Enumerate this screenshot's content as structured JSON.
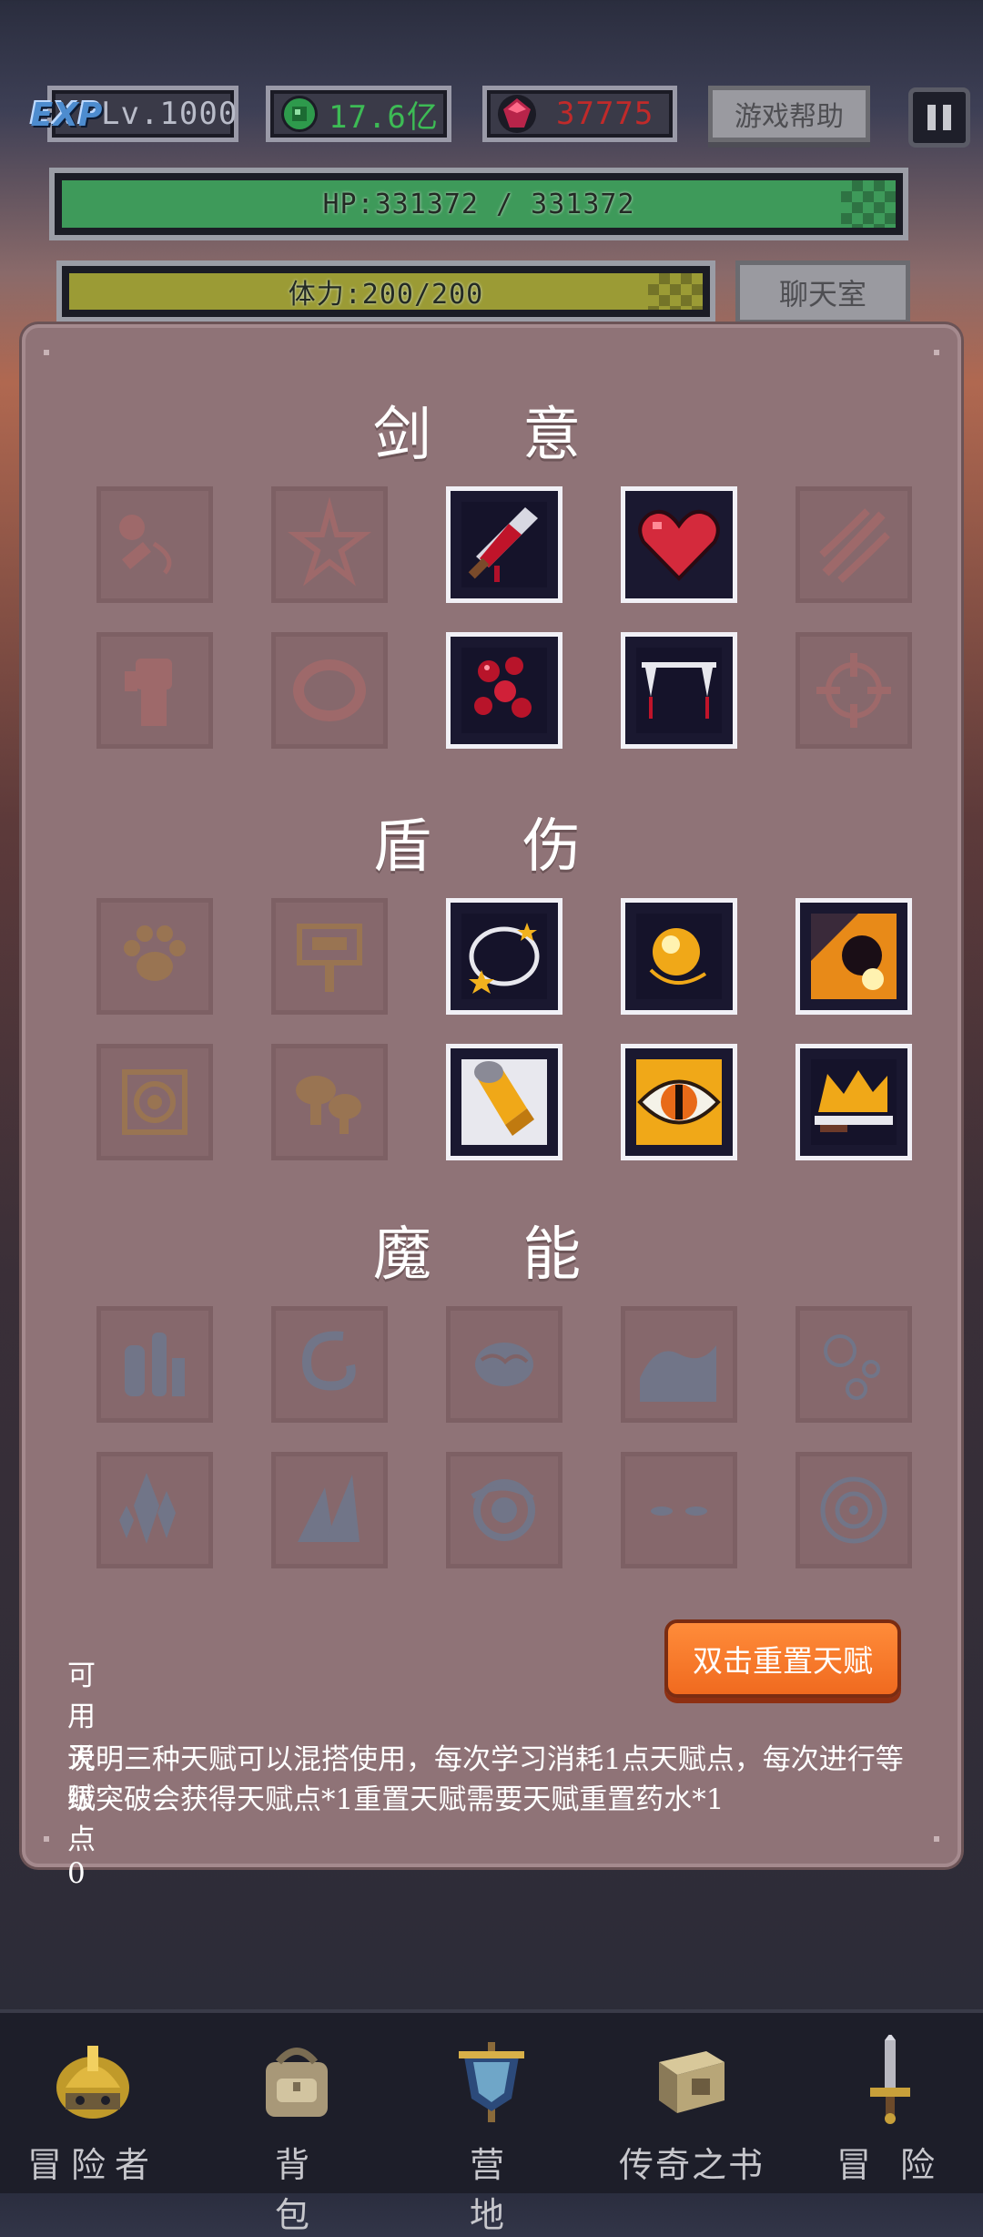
{
  "top": {
    "exp_badge": "EXP",
    "level": "Lv.1000",
    "gold": "17.6亿",
    "gems": "37775",
    "help_button": "游戏帮助",
    "hp_text": "HP:331372 / 331372",
    "stamina_text": "体力:200/200",
    "chat_button": "聊天室",
    "hp_fraction": 1.0,
    "stamina_fraction": 1.0
  },
  "talents": {
    "sections": [
      {
        "title": "剑 意",
        "slots": [
          {
            "icon": "club-icon",
            "unlocked": false
          },
          {
            "icon": "starfish-icon",
            "unlocked": false
          },
          {
            "icon": "bloody-dagger-icon",
            "unlocked": true
          },
          {
            "icon": "heart-icon",
            "unlocked": true
          },
          {
            "icon": "claw-slash-icon",
            "unlocked": false
          },
          {
            "icon": "fist-icon",
            "unlocked": false
          },
          {
            "icon": "ring-icon",
            "unlocked": false
          },
          {
            "icon": "blood-drops-icon",
            "unlocked": true
          },
          {
            "icon": "fangs-icon",
            "unlocked": true
          },
          {
            "icon": "crosshair-icon",
            "unlocked": false
          }
        ]
      },
      {
        "title": "盾 伤",
        "slots": [
          {
            "icon": "paw-icon",
            "unlocked": false
          },
          {
            "icon": "signpost-icon",
            "unlocked": false
          },
          {
            "icon": "star-ring-icon",
            "unlocked": true
          },
          {
            "icon": "golden-orb-icon",
            "unlocked": true
          },
          {
            "icon": "eclipse-icon",
            "unlocked": true
          },
          {
            "icon": "shield-target-icon",
            "unlocked": false
          },
          {
            "icon": "mushrooms-icon",
            "unlocked": false
          },
          {
            "icon": "bullet-icon",
            "unlocked": true
          },
          {
            "icon": "dragon-eye-icon",
            "unlocked": true
          },
          {
            "icon": "crown-sword-icon",
            "unlocked": true
          }
        ]
      },
      {
        "title": "魔 能",
        "slots": [
          {
            "icon": "potions-icon",
            "unlocked": false
          },
          {
            "icon": "swirl-icon",
            "unlocked": false
          },
          {
            "icon": "brain-icon",
            "unlocked": false
          },
          {
            "icon": "wave-icon",
            "unlocked": false
          },
          {
            "icon": "bubbles-icon",
            "unlocked": false
          },
          {
            "icon": "crystal-icon",
            "unlocked": false
          },
          {
            "icon": "ice-shards-icon",
            "unlocked": false
          },
          {
            "icon": "vortex-icon",
            "unlocked": false
          },
          {
            "icon": "shadow-eyes-icon",
            "unlocked": false
          },
          {
            "icon": "magic-circle-icon",
            "unlocked": false
          }
        ]
      }
    ],
    "available_points_label": "可用天赋点0",
    "reset_button": "双击重置天赋",
    "description": "说明三种天赋可以混搭使用，每次学习消耗1点天赋点，每次进行等级突破会获得天赋点*1重置天赋需要天赋重置药水*1"
  },
  "nav": [
    {
      "label": "冒险者",
      "icon": "helmet-icon"
    },
    {
      "label": "背包",
      "icon": "backpack-icon"
    },
    {
      "label": "营地",
      "icon": "camp-banner-icon"
    },
    {
      "label": "传奇之书",
      "icon": "book-icon"
    },
    {
      "label": "冒 险",
      "icon": "sword-icon"
    }
  ],
  "colors": {
    "hp": "#3e9a5a",
    "stamina": "#9b9b35",
    "panel": "#8f7377",
    "accent_button": "#f06a1f",
    "gold_text": "#3dbb55",
    "gem_text": "#c02a2a"
  }
}
